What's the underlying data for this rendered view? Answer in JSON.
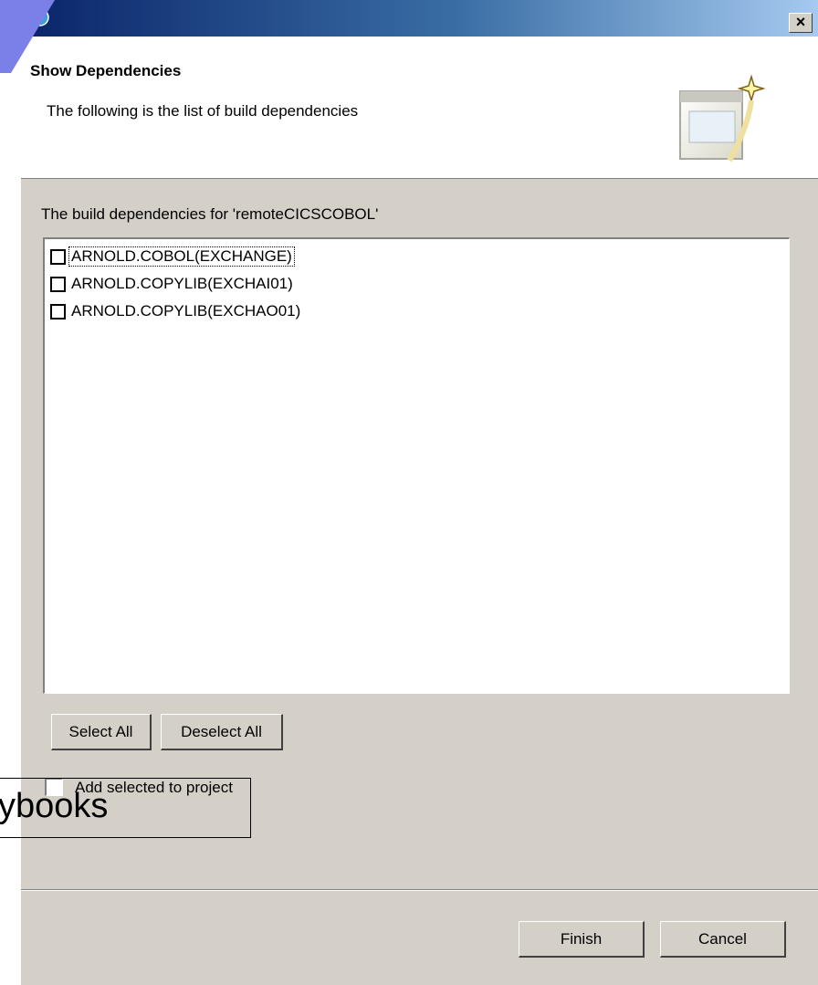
{
  "window": {
    "close_label": "×"
  },
  "header": {
    "title": "Show Dependencies",
    "description": "The following is the list of build dependencies"
  },
  "dependencies": {
    "label": "The build dependencies for 'remoteCICSCOBOL'",
    "items": [
      {
        "label": "ARNOLD.COBOL(EXCHANGE)",
        "checked": false,
        "focused": true
      },
      {
        "label": "ARNOLD.COPYLIB(EXCHAI01)",
        "checked": false,
        "focused": false
      },
      {
        "label": "ARNOLD.COPYLIB(EXCHAO01)",
        "checked": false,
        "focused": false
      }
    ]
  },
  "buttons": {
    "select_all": "Select All",
    "deselect_all": "Deselect All",
    "finish": "Finish",
    "cancel": "Cancel"
  },
  "add_to_project": {
    "label": "Add selected to project",
    "checked": false
  },
  "overlay": {
    "text": "ybooks"
  },
  "colors": {
    "titlebar_start": "#0a246a",
    "titlebar_end": "#a6caf0",
    "dialog_bg": "#d4d0c8",
    "corner_shape": "#7b7fe8"
  }
}
